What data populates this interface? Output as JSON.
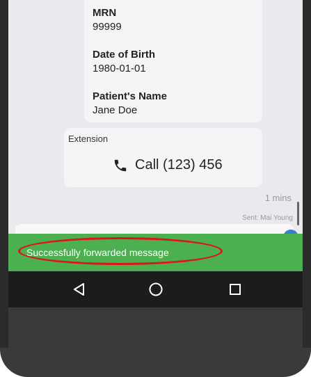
{
  "patient": {
    "mrn_label": "MRN",
    "mrn_value": "99999",
    "dob_label": "Date of Birth",
    "dob_value": "1980-01-01",
    "name_label": "Patient's Name",
    "name_value": "Jane Doe"
  },
  "extension": {
    "label": "Extension",
    "call_text": "Call (123) 456",
    "icon": "phone-icon"
  },
  "message_meta": {
    "time": "1 mins",
    "sent": "Sent: Mai Young"
  },
  "snackbar": {
    "text": "Successfully forwarded message",
    "color": "#4caf50"
  },
  "navbar": {
    "items": [
      "back-icon",
      "home-icon",
      "recents-icon"
    ]
  },
  "colors": {
    "highlight": "#e0121c",
    "chat_bg": "#ece9ee",
    "card_bg": "#f6f4f7"
  }
}
